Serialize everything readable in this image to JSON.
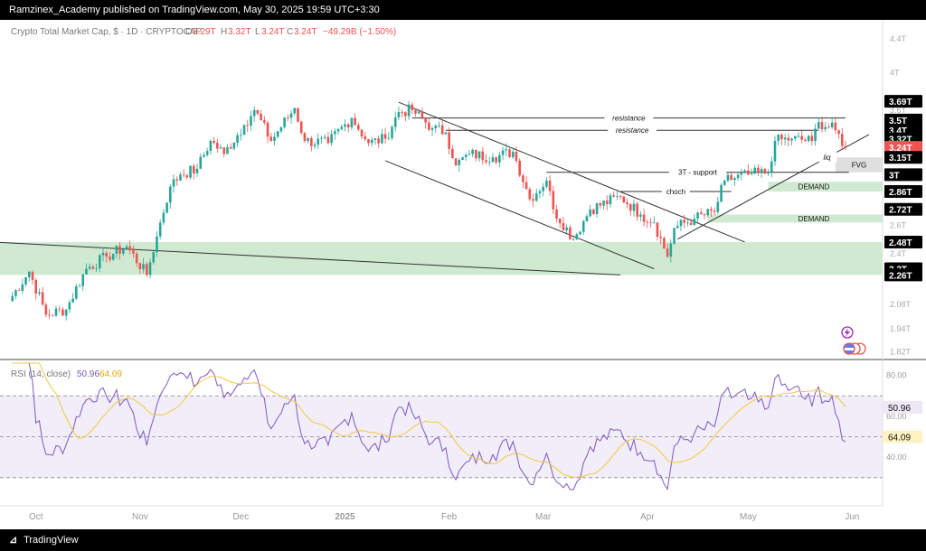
{
  "header": {
    "publisher": "Ramzinex_Academy published on TradingView.com, May 30, 2025 19:59 UTC+3:30"
  },
  "footer": {
    "brand": "TradingView",
    "logo_icon": "tradingview-logo-icon"
  },
  "legend": {
    "symbol": "Crypto Total Market Cap, $ · 1D · CRYPTOCAP",
    "o_label": "O",
    "o_value": "3.29T",
    "h_label": "H",
    "h_value": "3.32T",
    "l_label": "L",
    "l_value": "3.24T",
    "c_label": "C",
    "c_value": "3.24T",
    "change": "−49.29B (−1.50%)"
  },
  "rsi_legend": {
    "name": "RSI (14, close)",
    "rsi_value": "50.96",
    "ma_value": "64.09"
  },
  "colors": {
    "up": "#26a69a",
    "down": "#ef5350",
    "rsi": "#7e57c2",
    "rsi_ma": "#f5c542",
    "demand": "#c8e6c9",
    "fvg": "#d9d9d9",
    "price_tag": "#ef5350"
  },
  "chart_data": [
    {
      "type": "candlestick",
      "title": "Crypto Total Market Cap, $ · 1D · CRYPTOCAP",
      "x_ticks": [
        "Oct",
        "Nov",
        "Dec",
        "2025",
        "Feb",
        "Mar",
        "Apr",
        "May",
        "Jun"
      ],
      "y_ticks": [
        "4.4T",
        "4T",
        "3.6T",
        "3.39T",
        "3.3T",
        "2.6T",
        "2.4T",
        "2.08T",
        "1.94T",
        "1.82T"
      ],
      "y_scale": "log",
      "ylim": [
        1.78,
        4.55
      ],
      "grid": false,
      "price_labels": [
        "3.69T",
        "3.5T",
        "3.4T",
        "3.32T",
        "3.24T",
        "3.15T",
        "3T",
        "2.86T",
        "2.72T",
        "2.48T",
        "2.3T",
        "2.26T"
      ],
      "current_price": "3.24T",
      "anchors": [
        [
          "2024-09-23",
          2.1
        ],
        [
          "2024-09-29",
          2.28
        ],
        [
          "2024-10-04",
          2.02
        ],
        [
          "2024-10-10",
          2.05
        ],
        [
          "2024-10-16",
          2.3
        ],
        [
          "2024-10-22",
          2.38
        ],
        [
          "2024-10-28",
          2.45
        ],
        [
          "2024-11-03",
          2.26
        ],
        [
          "2024-11-06",
          2.52
        ],
        [
          "2024-11-10",
          2.9
        ],
        [
          "2024-11-13",
          3.0
        ],
        [
          "2024-11-18",
          3.05
        ],
        [
          "2024-11-22",
          3.3
        ],
        [
          "2024-11-26",
          3.18
        ],
        [
          "2024-12-02",
          3.45
        ],
        [
          "2024-12-05",
          3.6
        ],
        [
          "2024-12-10",
          3.3
        ],
        [
          "2024-12-17",
          3.62
        ],
        [
          "2024-12-20",
          3.3
        ],
        [
          "2024-12-27",
          3.28
        ],
        [
          "2025-01-03",
          3.52
        ],
        [
          "2025-01-08",
          3.28
        ],
        [
          "2025-01-13",
          3.32
        ],
        [
          "2025-01-17",
          3.58
        ],
        [
          "2025-01-21",
          3.6
        ],
        [
          "2025-01-27",
          3.42
        ],
        [
          "2025-01-31",
          3.38
        ],
        [
          "2025-02-03",
          3.08
        ],
        [
          "2025-02-07",
          3.18
        ],
        [
          "2025-02-14",
          3.15
        ],
        [
          "2025-02-20",
          3.2
        ],
        [
          "2025-02-25",
          2.8
        ],
        [
          "2025-03-02",
          2.95
        ],
        [
          "2025-03-04",
          2.72
        ],
        [
          "2025-03-10",
          2.5
        ],
        [
          "2025-03-15",
          2.72
        ],
        [
          "2025-03-24",
          2.82
        ],
        [
          "2025-03-30",
          2.68
        ],
        [
          "2025-04-03",
          2.62
        ],
        [
          "2025-04-07",
          2.38
        ],
        [
          "2025-04-09",
          2.58
        ],
        [
          "2025-04-15",
          2.65
        ],
        [
          "2025-04-21",
          2.7
        ],
        [
          "2025-04-24",
          2.95
        ],
        [
          "2025-05-01",
          3.0
        ],
        [
          "2025-05-07",
          3.02
        ],
        [
          "2025-05-09",
          3.3
        ],
        [
          "2025-05-14",
          3.32
        ],
        [
          "2025-05-20",
          3.3
        ],
        [
          "2025-05-22",
          3.48
        ],
        [
          "2025-05-27",
          3.4
        ],
        [
          "2025-05-30",
          3.24
        ]
      ],
      "zones": [
        {
          "label": "",
          "kind": "demand",
          "from": "2024-09-18",
          "to": "2025-06-12",
          "low": 2.26,
          "high": 2.48
        },
        {
          "label": "DEMAND",
          "kind": "demand",
          "from": "2025-04-19",
          "to": "2025-06-12",
          "low": 2.62,
          "high": 2.68
        },
        {
          "label": "DEMAND",
          "kind": "demand",
          "from": "2025-05-07",
          "to": "2025-06-12",
          "low": 2.86,
          "high": 2.94
        },
        {
          "label": "FVG",
          "kind": "fvg",
          "from": "2025-05-27",
          "to": "2025-06-12",
          "low": 3.02,
          "high": 3.15
        }
      ],
      "annotations": [
        {
          "label": "resistance",
          "from": "2025-01-21",
          "to": "2025-05-30",
          "y": 3.52
        },
        {
          "label": "resistance",
          "from": "2025-01-31",
          "to": "2025-05-22",
          "y": 3.4
        },
        {
          "label": "liq",
          "from": "2025-05-22",
          "to": "2025-05-27",
          "y": 3.15
        },
        {
          "label": "3T - support",
          "from": "2025-03-02",
          "to": "2025-05-31",
          "y": 3.02
        },
        {
          "label": "choch",
          "from": "2025-03-24",
          "to": "2025-04-26",
          "y": 2.86
        }
      ],
      "trendlines": [
        {
          "from": [
            "2024-09-18",
            2.48
          ],
          "to": [
            "2025-03-24",
            2.26
          ]
        },
        {
          "from": [
            "2025-01-17",
            3.68
          ],
          "to": [
            "2025-04-30",
            2.48
          ]
        },
        {
          "from": [
            "2025-01-13",
            3.12
          ],
          "to": [
            "2025-04-03",
            2.3
          ]
        },
        {
          "from": [
            "2025-04-10",
            2.5
          ],
          "to": [
            "2025-06-06",
            3.36
          ]
        }
      ]
    },
    {
      "type": "line",
      "title": "RSI (14, close)",
      "y_ticks": [
        "80.00",
        "60.00",
        "40.00"
      ],
      "ylim": [
        18,
        86
      ],
      "bands": [
        70,
        50,
        30
      ],
      "series": [
        {
          "name": "RSI",
          "value_label": "50.96"
        },
        {
          "name": "RSI-based MA",
          "value_label": "64.09"
        }
      ]
    }
  ]
}
